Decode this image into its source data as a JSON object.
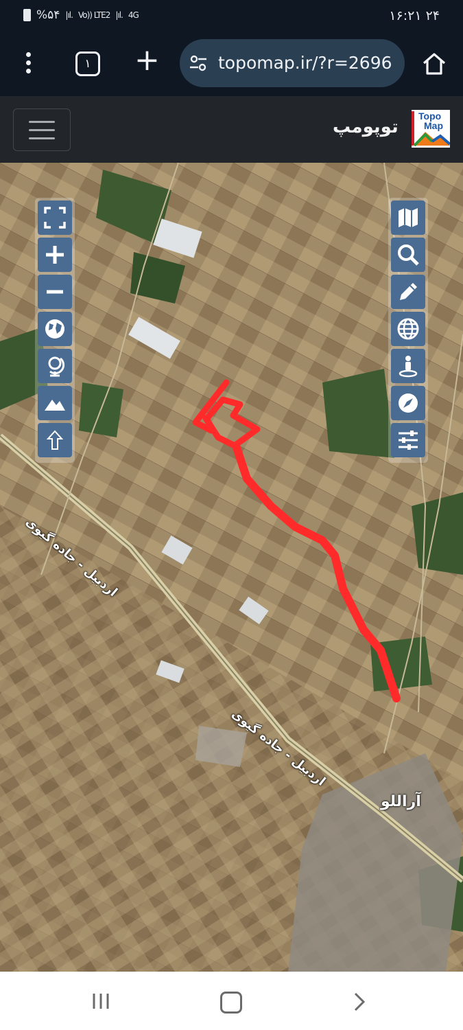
{
  "status_bar": {
    "battery": "%۵۴",
    "signal1": "Vo)) LTE2",
    "network": "4G",
    "time": "۲۴ ۱۶:۲۱"
  },
  "browser": {
    "tab_count": "۱",
    "url": "topomap.ir/?r=2696",
    "icons": [
      "more-icon",
      "tabs-icon",
      "plus-icon",
      "site-settings-icon",
      "home-icon"
    ]
  },
  "site_header": {
    "title": "توپومپ",
    "logo_text_1": "Topo",
    "logo_text_2": "Map"
  },
  "map": {
    "left_toolbar": [
      "fullscreen-icon",
      "zoom-in-icon",
      "zoom-out-icon",
      "globe-icon",
      "desk-globe-icon",
      "terrain-icon",
      "arrow-up-icon"
    ],
    "right_toolbar": [
      "map-icon",
      "search-icon",
      "pencil-icon",
      "web-globe-icon",
      "person-pin-icon",
      "compass-icon",
      "sliders-icon"
    ],
    "labels": {
      "road_upper": "اردبیل - جاده گیوی",
      "road_lower": "اردبیل - جاده گیوی",
      "village": "آراللو"
    },
    "route_color": "#ff2b2b"
  },
  "nav_bar": {
    "icons": [
      "recent-apps-icon",
      "home-button-icon",
      "back-icon"
    ]
  }
}
